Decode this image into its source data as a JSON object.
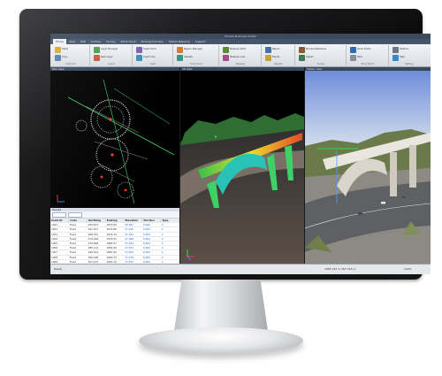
{
  "app": {
    "title": "Trimble Business Center",
    "tabs": [
      "Home",
      "View",
      "Edit",
      "Surface",
      "Survey",
      "Point Cloud",
      "Photogrammetry",
      "Mobile Mapping",
      "Support"
    ],
    "active_tab_index": 0
  },
  "ribbon": {
    "groups": [
      {
        "label": "Clipboard",
        "buttons": [
          "Paste",
          "Copy"
        ]
      },
      {
        "label": "Layers",
        "buttons": [
          "Layer Manager",
          "New Layer"
        ]
      },
      {
        "label": "Insert",
        "buttons": [
          "Insert Point",
          "Insert Line"
        ]
      },
      {
        "label": "Point Cloud",
        "buttons": [
          "Region Manager",
          "Classify"
        ]
      },
      {
        "label": "Measure",
        "buttons": [
          "Measure Point",
          "Measure Line"
        ]
      },
      {
        "label": "Reports",
        "buttons": [
          "Report",
          "Export"
        ]
      },
      {
        "label": "Survey",
        "buttons": [
          "Process Baselines",
          "Adjust"
        ]
      },
      {
        "label": "Show Points",
        "buttons": [
          "Show Points",
          "Hide"
        ]
      },
      {
        "label": "Settings",
        "buttons": [
          "Options",
          "Help"
        ]
      }
    ]
  },
  "panes": {
    "plan": {
      "title": "Plan View"
    },
    "view3d": {
      "title": "3D View"
    },
    "station": {
      "title": "Station View"
    }
  },
  "table": {
    "title": "Results",
    "columns": [
      "Point ID",
      "Code",
      "Northing",
      "Easting",
      "Elevation",
      "Std Dev",
      "Type"
    ],
    "rows": [
      [
        "1001",
        "Fixed",
        "245.613",
        "1870.05",
        "36.941",
        "0.002",
        "C"
      ],
      [
        "1002",
        "Fixed",
        "261.027",
        "1872.88",
        "37.015",
        "0.003",
        "C"
      ],
      [
        "1003",
        "Fixed",
        "268.351",
        "1876.44",
        "37.102",
        "0.002",
        "C"
      ],
      [
        "1004",
        "Fixed",
        "274.092",
        "1879.31",
        "37.188",
        "0.004",
        "C"
      ],
      [
        "1005",
        "Fixed",
        "279.660",
        "1882.07",
        "37.260",
        "0.003",
        "C"
      ],
      [
        "1006",
        "Fixed",
        "285.114",
        "1884.90",
        "37.331",
        "0.002",
        "C"
      ],
      [
        "1007",
        "Fixed",
        "290.543",
        "1887.62",
        "37.409",
        "0.003",
        "C"
      ],
      [
        "1008",
        "Fixed",
        "296.008",
        "1890.33",
        "37.478",
        "0.002",
        "C"
      ],
      [
        "1009",
        "Fixed",
        "301.472",
        "1893.10",
        "37.553",
        "0.004",
        "C"
      ],
      [
        "1010",
        "Fixed",
        "306.929",
        "1895.84",
        "37.621",
        "0.003",
        "C"
      ],
      [
        "1011",
        "Fixed",
        "312.385",
        "1898.57",
        "37.694",
        "0.002",
        "C"
      ]
    ]
  },
  "status": {
    "left": "Ready",
    "coordinates": "1885.742 m  267.318 m",
    "zoom": "100%"
  }
}
